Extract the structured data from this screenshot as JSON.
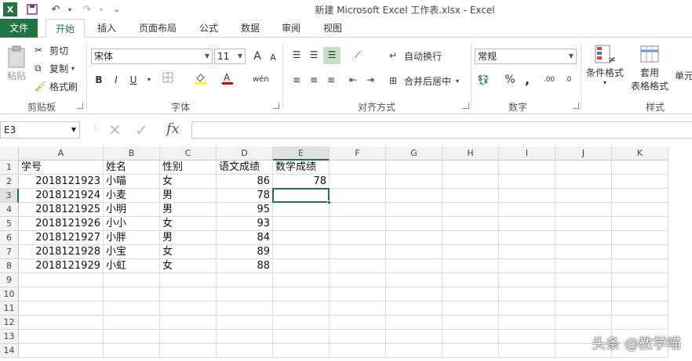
{
  "window": {
    "title": "新建 Microsoft Excel 工作表.xlsx - Excel"
  },
  "tabs": [
    "文件",
    "开始",
    "插入",
    "页面布局",
    "公式",
    "数据",
    "审阅",
    "视图"
  ],
  "clipboard": {
    "paste": "粘贴",
    "cut": "剪切",
    "copy": "复制",
    "format_painter": "格式刷",
    "label": "剪贴板"
  },
  "font": {
    "name": "宋体",
    "size": "11",
    "bold": "B",
    "italic": "I",
    "underline": "U",
    "label": "字体",
    "grow": "A",
    "shrink": "A"
  },
  "alignment": {
    "wrap": "自动换行",
    "merge": "合并后居中",
    "label": "对齐方式"
  },
  "number": {
    "format": "常规",
    "percent": "%",
    "comma": ",",
    "label": "数字"
  },
  "styles": {
    "conditional": "条件格式",
    "table1": "套用",
    "table2": "表格格式",
    "cell": "单元",
    "label": "样式"
  },
  "formula_bar": {
    "name_box": "E3",
    "fx": "fx",
    "value": ""
  },
  "columns": [
    "A",
    "B",
    "C",
    "D",
    "E",
    "F",
    "G",
    "H",
    "I",
    "J",
    "K"
  ],
  "rows": [
    "1",
    "2",
    "3",
    "4",
    "5",
    "6",
    "7",
    "8",
    "9",
    "10",
    "11",
    "12",
    "13",
    "14"
  ],
  "cells": [
    [
      "学号",
      "姓名",
      "性别",
      "语文成绩",
      "数学成绩"
    ],
    [
      "2018121923",
      "小喵",
      "女",
      "86",
      "78"
    ],
    [
      "2018121924",
      "小麦",
      "男",
      "78",
      ""
    ],
    [
      "2018121925",
      "小明",
      "男",
      "95",
      ""
    ],
    [
      "2018121926",
      "小小",
      "女",
      "93",
      ""
    ],
    [
      "2018121927",
      "小胖",
      "男",
      "84",
      ""
    ],
    [
      "2018121928",
      "小宝",
      "女",
      "89",
      ""
    ],
    [
      "2018121929",
      "小虹",
      "女",
      "88",
      ""
    ]
  ],
  "selected_cell": "E3",
  "watermark": "头条 @教学喵"
}
